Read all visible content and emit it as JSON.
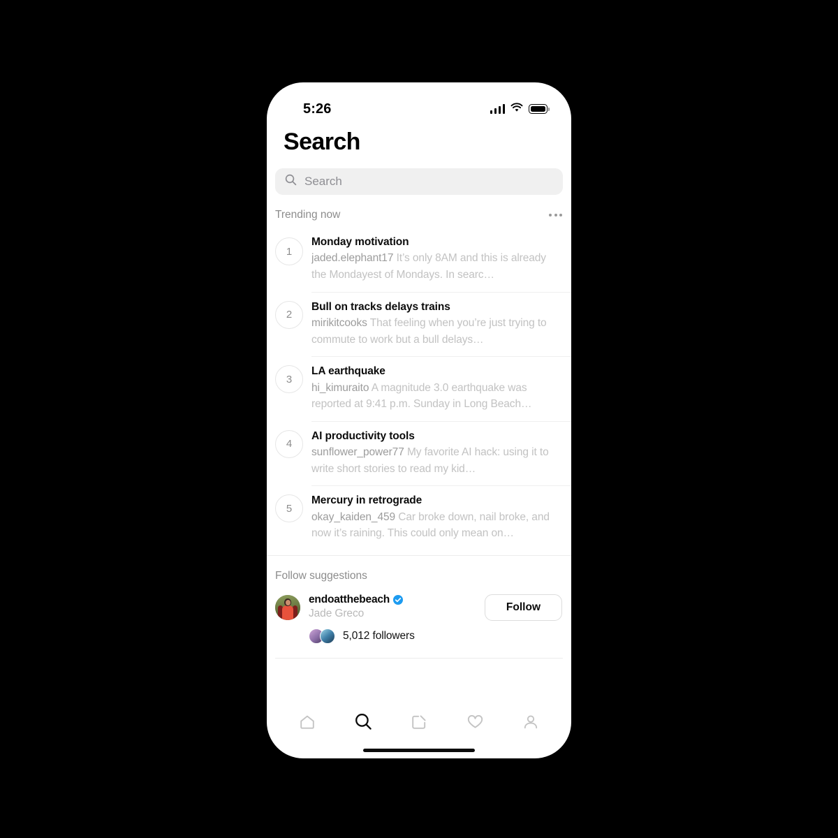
{
  "status_bar": {
    "time": "5:26",
    "signal_icon": "cellular-signal-icon",
    "wifi_icon": "wifi-icon",
    "battery_icon": "battery-full-icon"
  },
  "header": {
    "title": "Search"
  },
  "search": {
    "placeholder": "Search",
    "value": "",
    "icon": "search-icon"
  },
  "trending": {
    "section_title": "Trending now",
    "overflow_icon": "more-horizontal-icon",
    "items": [
      {
        "rank": "1",
        "title": "Monday motivation",
        "handle": "jaded.elephant17",
        "snippet": "It’s only 8AM and this is already the Mondayest of Mondays. In searc…"
      },
      {
        "rank": "2",
        "title": "Bull on tracks delays trains",
        "handle": "mirikitcooks",
        "snippet": "That feeling when you’re just trying to commute to work but a bull delays…"
      },
      {
        "rank": "3",
        "title": "LA earthquake",
        "handle": "hi_kimuraito",
        "snippet": "A magnitude 3.0 earthquake was reported at 9:41 p.m. Sunday in Long Beach…"
      },
      {
        "rank": "4",
        "title": "AI productivity tools",
        "handle": "sunflower_power77",
        "snippet": "My favorite AI hack: using it to write short stories to read my kid…"
      },
      {
        "rank": "5",
        "title": "Mercury in retrograde",
        "handle": "okay_kaiden_459",
        "snippet": "Car broke down, nail broke, and now it’s raining. This could only mean on…"
      }
    ]
  },
  "follow_suggestions": {
    "section_title": "Follow suggestions",
    "user": {
      "handle": "endoatthebeach",
      "display_name": "Jade Greco",
      "verified": true,
      "verified_icon": "verified-badge-icon",
      "followers_text": "5,012 followers",
      "avatar_icon": "user-avatar-photo"
    },
    "follow_label": "Follow"
  },
  "tab_bar": {
    "items": [
      {
        "name": "home-icon",
        "label": "Home",
        "active": false
      },
      {
        "name": "search-icon",
        "label": "Search",
        "active": true
      },
      {
        "name": "compose-icon",
        "label": "Compose",
        "active": false
      },
      {
        "name": "heart-icon",
        "label": "Activity",
        "active": false
      },
      {
        "name": "profile-icon",
        "label": "Profile",
        "active": false
      }
    ]
  },
  "colors": {
    "background": "#000000",
    "screen": "#ffffff",
    "accent_verified": "#1d9bf0",
    "text_primary": "#0b0b0b",
    "text_secondary": "#8c8c8c",
    "text_muted": "#c2c2c2",
    "search_field": "#f0f0f0",
    "divider": "#ececec"
  }
}
